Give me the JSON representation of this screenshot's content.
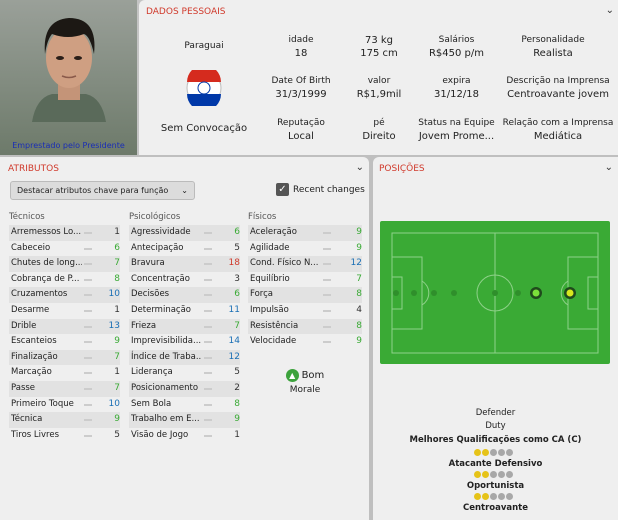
{
  "player": {
    "loan_status": "Emprestado pelo Presidente"
  },
  "personal": {
    "title": "DADOS PESSOAIS",
    "nation": "Paraguai",
    "call_up": "Sem Convocação",
    "age_l": "idade",
    "age": "18",
    "weight": "73 kg",
    "height": "175 cm",
    "wage_l": "Salários",
    "wage": "R$450 p/m",
    "pers_l": "Personalidade",
    "pers": "Realista",
    "dob_l": "Date Of Birth",
    "dob": "31/3/1999",
    "value_l": "valor",
    "value": "R$1,9mil",
    "exp_l": "expira",
    "exp": "31/12/18",
    "media_l": "Descrição na Imprensa",
    "media": "Centroavante jovem",
    "rep_l": "Reputação",
    "rep": "Local",
    "foot_l": "pé",
    "foot": "Direito",
    "squad_l": "Status na Equipe",
    "squad": "Jovem Prome...",
    "press_l": "Relação com a Imprensa",
    "press": "Mediática"
  },
  "attributes": {
    "title": "ATRIBUTOS",
    "highlight": "Destacar atributos chave para função",
    "recent": "Recent changes",
    "tech_h": "Técnicos",
    "mental_h": "Psicológicos",
    "phys_h": "Físicos",
    "technical": [
      [
        "Arremessos Lo...",
        "1"
      ],
      [
        "Cabeceio",
        "6"
      ],
      [
        "Chutes de long...",
        "7"
      ],
      [
        "Cobrança de P...",
        "8"
      ],
      [
        "Cruzamentos",
        "10"
      ],
      [
        "Desarme",
        "1"
      ],
      [
        "Drible",
        "13"
      ],
      [
        "Escanteios",
        "9"
      ],
      [
        "Finalização",
        "7"
      ],
      [
        "Marcação",
        "1"
      ],
      [
        "Passe",
        "7"
      ],
      [
        "Primeiro Toque",
        "10"
      ],
      [
        "Técnica",
        "9"
      ],
      [
        "Tiros Livres",
        "5"
      ]
    ],
    "mental": [
      [
        "Agressividade",
        "6"
      ],
      [
        "Antecipação",
        "5"
      ],
      [
        "Bravura",
        "18"
      ],
      [
        "Concentração",
        "3"
      ],
      [
        "Decisões",
        "6"
      ],
      [
        "Determinação",
        "11"
      ],
      [
        "Frieza",
        "7"
      ],
      [
        "Imprevisibilida...",
        "14"
      ],
      [
        "Índice de Traba...",
        "12"
      ],
      [
        "Liderança",
        "5"
      ],
      [
        "Posicionamento",
        "2"
      ],
      [
        "Sem Bola",
        "8"
      ],
      [
        "Trabalho em E...",
        "9"
      ],
      [
        "Visão de Jogo",
        "1"
      ]
    ],
    "physical": [
      [
        "Aceleração",
        "9"
      ],
      [
        "Agilidade",
        "9"
      ],
      [
        "Cond. Físico N...",
        "12"
      ],
      [
        "Equilíbrio",
        "7"
      ],
      [
        "Força",
        "8"
      ],
      [
        "Impulsão",
        "4"
      ],
      [
        "Resistência",
        "8"
      ],
      [
        "Velocidade",
        "9"
      ]
    ],
    "morale_value": "Bom",
    "morale_label": "Morale"
  },
  "positions": {
    "title": "POSIÇÕES",
    "role": "Defender",
    "duty": "Duty",
    "best": "Melhores Qualificações como CA (C)",
    "roles": [
      {
        "name": "Atacante Defensivo",
        "stars": 2
      },
      {
        "name": "Oportunista",
        "stars": 2
      },
      {
        "name": "Centroavante",
        "stars": 2
      }
    ]
  },
  "colors": {
    "accent": "#d0392b",
    "green": "#3aaa35",
    "blue": "#1a6fb5",
    "red": "#d0392b"
  }
}
